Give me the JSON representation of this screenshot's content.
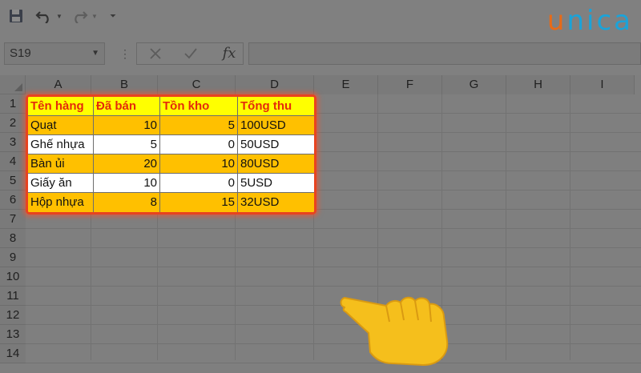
{
  "toolbar": {
    "save_icon": "floppy-disk-icon",
    "undo_icon": "undo-icon",
    "redo_icon": "redo-icon",
    "customize_icon": "customize-qat-icon"
  },
  "brand": {
    "logo_part1": "u",
    "logo_part2": "nica",
    "color1": "#e86a17",
    "color2": "#1aa3d9"
  },
  "formula_bar": {
    "name_box": "S19",
    "cancel_icon": "cancel-x-icon",
    "enter_icon": "checkmark-icon",
    "fx_label": "fx",
    "formula_value": ""
  },
  "columns": [
    "A",
    "B",
    "C",
    "D",
    "E",
    "F",
    "G",
    "H",
    "I"
  ],
  "rows": [
    "1",
    "2",
    "3",
    "4",
    "5",
    "6",
    "7",
    "8",
    "9",
    "10",
    "11",
    "12",
    "13",
    "14"
  ],
  "table": {
    "headers": [
      "Tên hàng",
      "Đã bán",
      "Tồn kho",
      "Tổng thu"
    ],
    "data": [
      [
        "Quạt",
        "10",
        "5",
        "100USD"
      ],
      [
        "Ghế nhựa",
        "5",
        "0",
        "50USD"
      ],
      [
        "Bàn ủi",
        "20",
        "10",
        "80USD"
      ],
      [
        "Giấy ăn",
        "10",
        "0",
        "5USD"
      ],
      [
        "Hộp nhựa",
        "8",
        "15",
        "32USD"
      ]
    ]
  },
  "colors": {
    "header_fill": "#ffff00",
    "header_text": "#e42a0b",
    "band_fill": "#ffc000",
    "highlight_border": "#e8431f",
    "hand": "#f5bf1c"
  },
  "pointer": "pointing-hand-icon"
}
